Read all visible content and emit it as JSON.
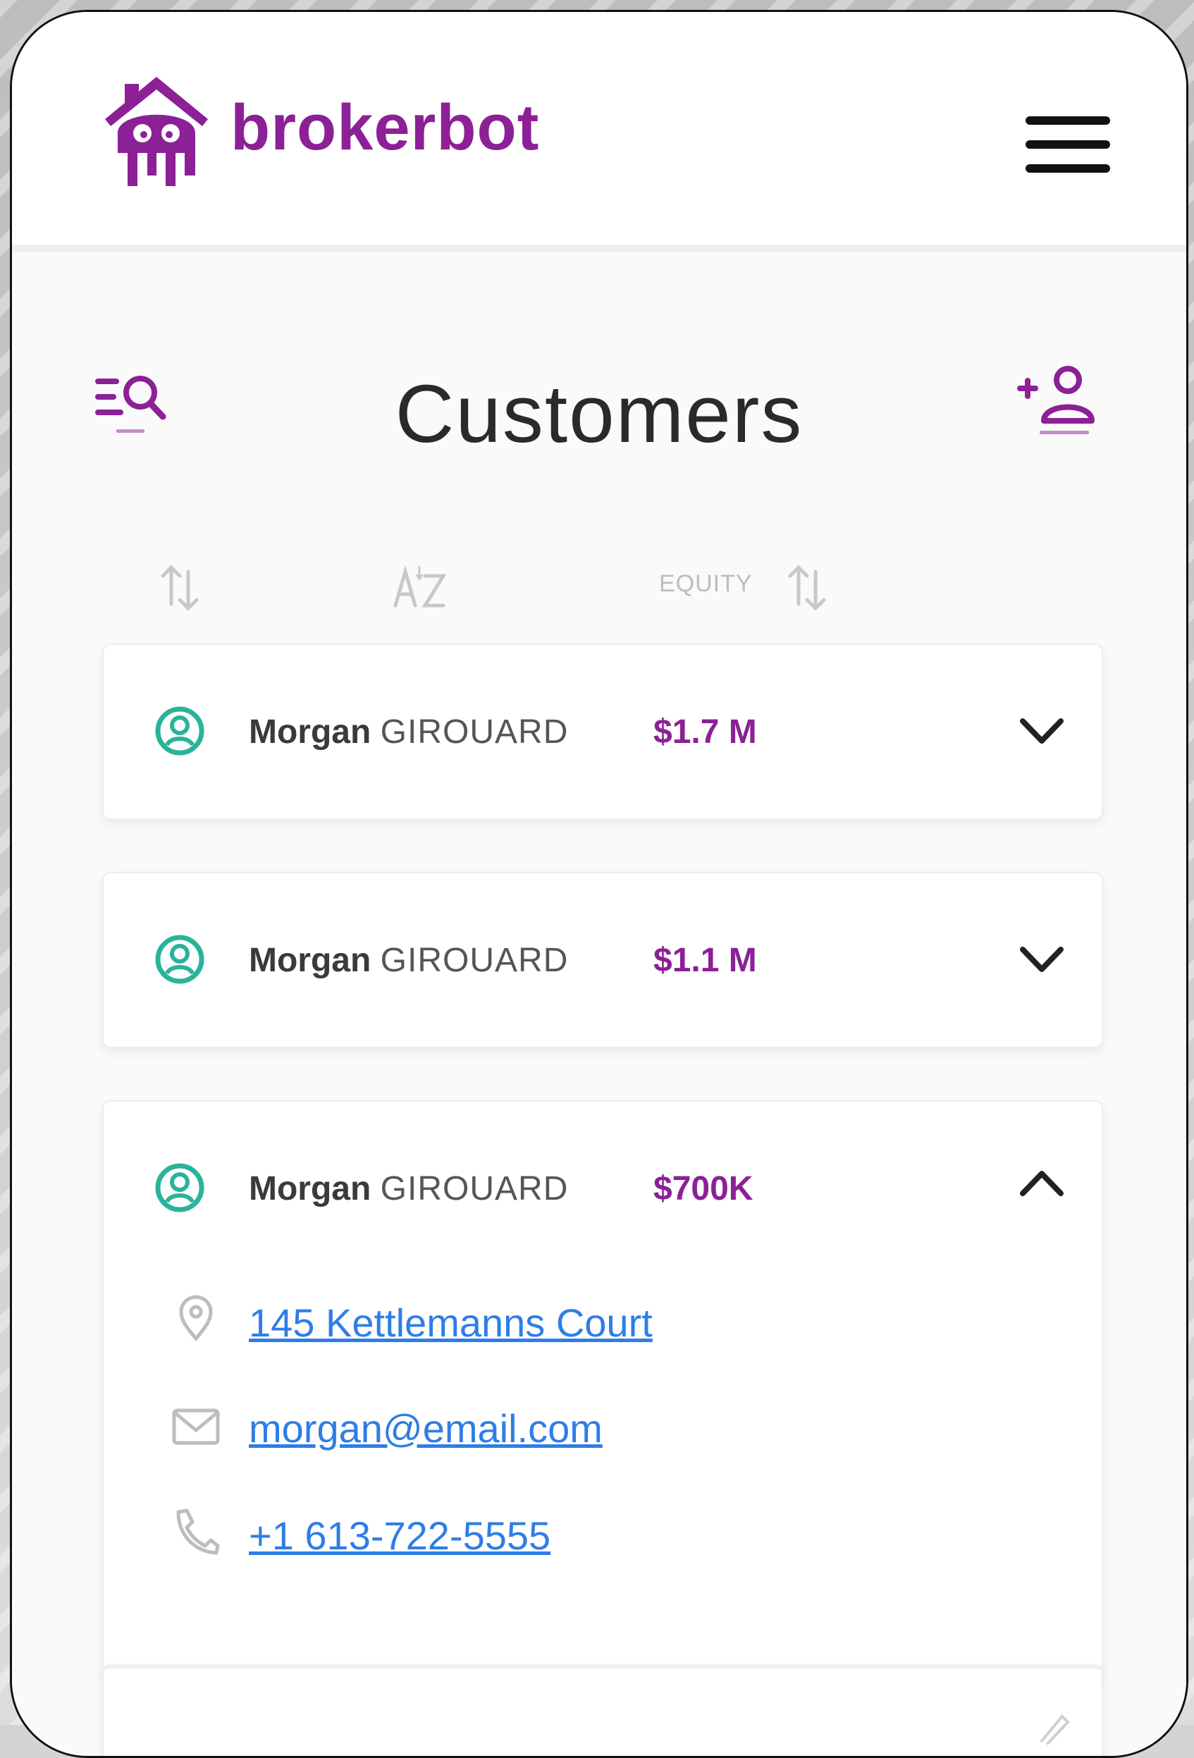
{
  "app": {
    "brand": "brokerbot"
  },
  "header": {
    "menu_icon": "hamburger-menu-icon"
  },
  "page": {
    "title": "Customers",
    "filter_icon": "search-filter-icon",
    "add_icon": "add-user-icon"
  },
  "sort": {
    "equity_label": "EQUITY"
  },
  "customers": [
    {
      "first": "Morgan",
      "last": "GIROUARD",
      "equity": "$1.7 M",
      "expanded": false
    },
    {
      "first": "Morgan",
      "last": "GIROUARD",
      "equity": "$1.1 M",
      "expanded": false
    },
    {
      "first": "Morgan",
      "last": "GIROUARD",
      "equity": "$700K",
      "expanded": true,
      "address": "145 Kettlemanns Court",
      "email": "morgan@email.com",
      "phone": "+1 613-722-5555"
    }
  ],
  "colors": {
    "brand": "#8c2096",
    "avatar": "#2bb39a",
    "link": "#2f7de6"
  }
}
